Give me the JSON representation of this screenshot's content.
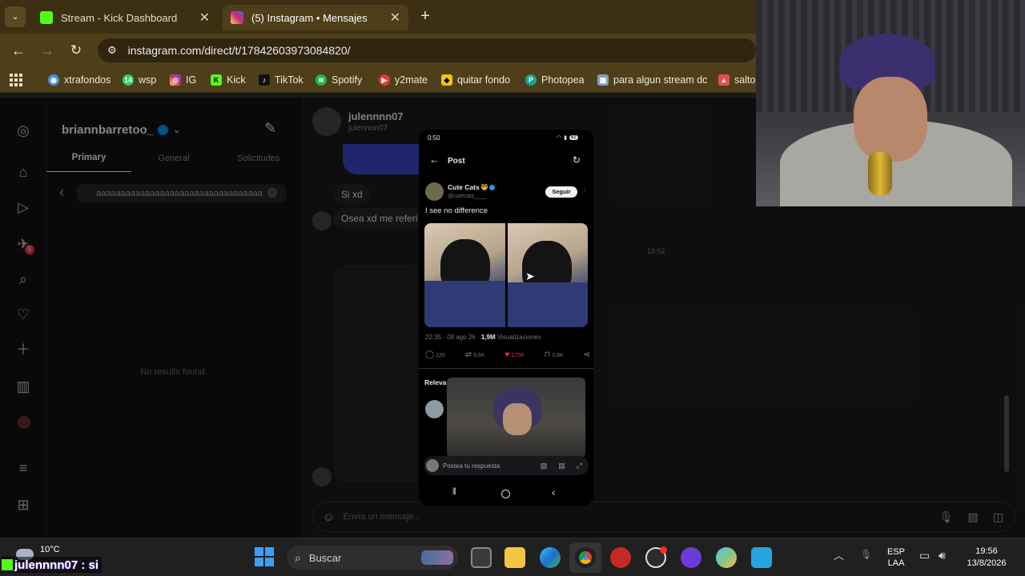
{
  "browser": {
    "tabs": [
      {
        "title": "Stream - Kick Dashboard",
        "favicon_color": "#53fc18"
      },
      {
        "title": "(5) Instagram • Mensajes",
        "favicon_color": "#d62976"
      }
    ],
    "new_tab_symbol": "+",
    "url": "instagram.com/direct/t/17842603973084820/",
    "bookmarks": [
      {
        "label": "xtrafondos",
        "icon": "eye-icon",
        "color": "#4a90e2"
      },
      {
        "label": "wsp",
        "icon": "whatsapp-icon",
        "color": "#25d366",
        "badge": "14"
      },
      {
        "label": "IG",
        "icon": "instagram-icon",
        "color": "#d62976"
      },
      {
        "label": "Kick",
        "icon": "kick-icon",
        "color": "#53fc18"
      },
      {
        "label": "TikTok",
        "icon": "tiktok-icon",
        "color": "#111111"
      },
      {
        "label": "Spotify",
        "icon": "spotify-icon",
        "color": "#1db954"
      },
      {
        "label": "y2mate",
        "icon": "y2mate-icon",
        "color": "#e53935"
      },
      {
        "label": "quitar fondo",
        "icon": "removebg-icon",
        "color": "#f5c400"
      },
      {
        "label": "Photopea",
        "icon": "photopea-icon",
        "color": "#18a497"
      },
      {
        "label": "para algun stream dc",
        "icon": "bookmark-page-icon",
        "color": "#7aa0c4"
      },
      {
        "label": "salto",
        "icon": "bookmark-tree-icon",
        "color": "#e05050"
      }
    ]
  },
  "instagram": {
    "username": "briannbarretoo_",
    "tabs": [
      "Primary",
      "General",
      "Solicitudes"
    ],
    "search_value": "aaaaaaaaaaaaaaaaaaaaaaaaaaaaaaaaaa",
    "no_results": "No results found.",
    "notification_badge": "5",
    "chat": {
      "contact_name": "julennnn07",
      "contact_handle": "julennnn07",
      "messages": [
        "Si xd",
        "Osea xd me referi"
      ],
      "timestamp": "19:52",
      "composer_placeholder": "Envía un mensaje..."
    }
  },
  "phone": {
    "status_time": "0:50",
    "battery": "62",
    "header_title": "Post",
    "author_name": "Cute Cats",
    "author_handle": "@cutecats____",
    "follow_label": "Seguir",
    "post_text": "I see no difference",
    "meta_time": "22:35 · 08 ago 26 · ",
    "meta_views_count": "1,9M",
    "meta_views_label": " Visualizaciones",
    "stats": {
      "replies": "126",
      "reposts": "9,6K",
      "likes": "175K",
      "bookmarks": "3,8K"
    },
    "relevant_label": "Releva",
    "reply_placeholder": "Postea tu respuesta"
  },
  "taskbar": {
    "weather_temp": "10°C",
    "chat_overlay": "julennnn07 : si",
    "search_placeholder": "Buscar",
    "language_top": "ESP",
    "language_bottom": "LAA",
    "time": "19:56",
    "date": "13/8/2026"
  },
  "colors": {
    "browser_frame": "#4e3f1a",
    "instagram_bg": "#121212",
    "like_pink": "#f91880",
    "verified_blue": "#1d9bf0"
  }
}
